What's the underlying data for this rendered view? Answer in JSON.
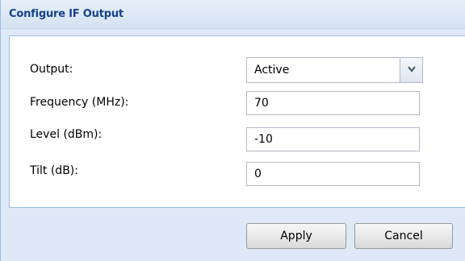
{
  "dialog": {
    "title": "Configure IF Output"
  },
  "form": {
    "output": {
      "label": "Output:",
      "value": "Active"
    },
    "frequency": {
      "label": "Frequency (MHz):",
      "value": "70"
    },
    "level": {
      "label": "Level (dBm):",
      "value": "-10"
    },
    "tilt": {
      "label": "Tilt (dB):",
      "value": "0"
    }
  },
  "buttons": {
    "apply": "Apply",
    "cancel": "Cancel"
  },
  "icons": {
    "dropdown": "chevron-down-icon"
  }
}
